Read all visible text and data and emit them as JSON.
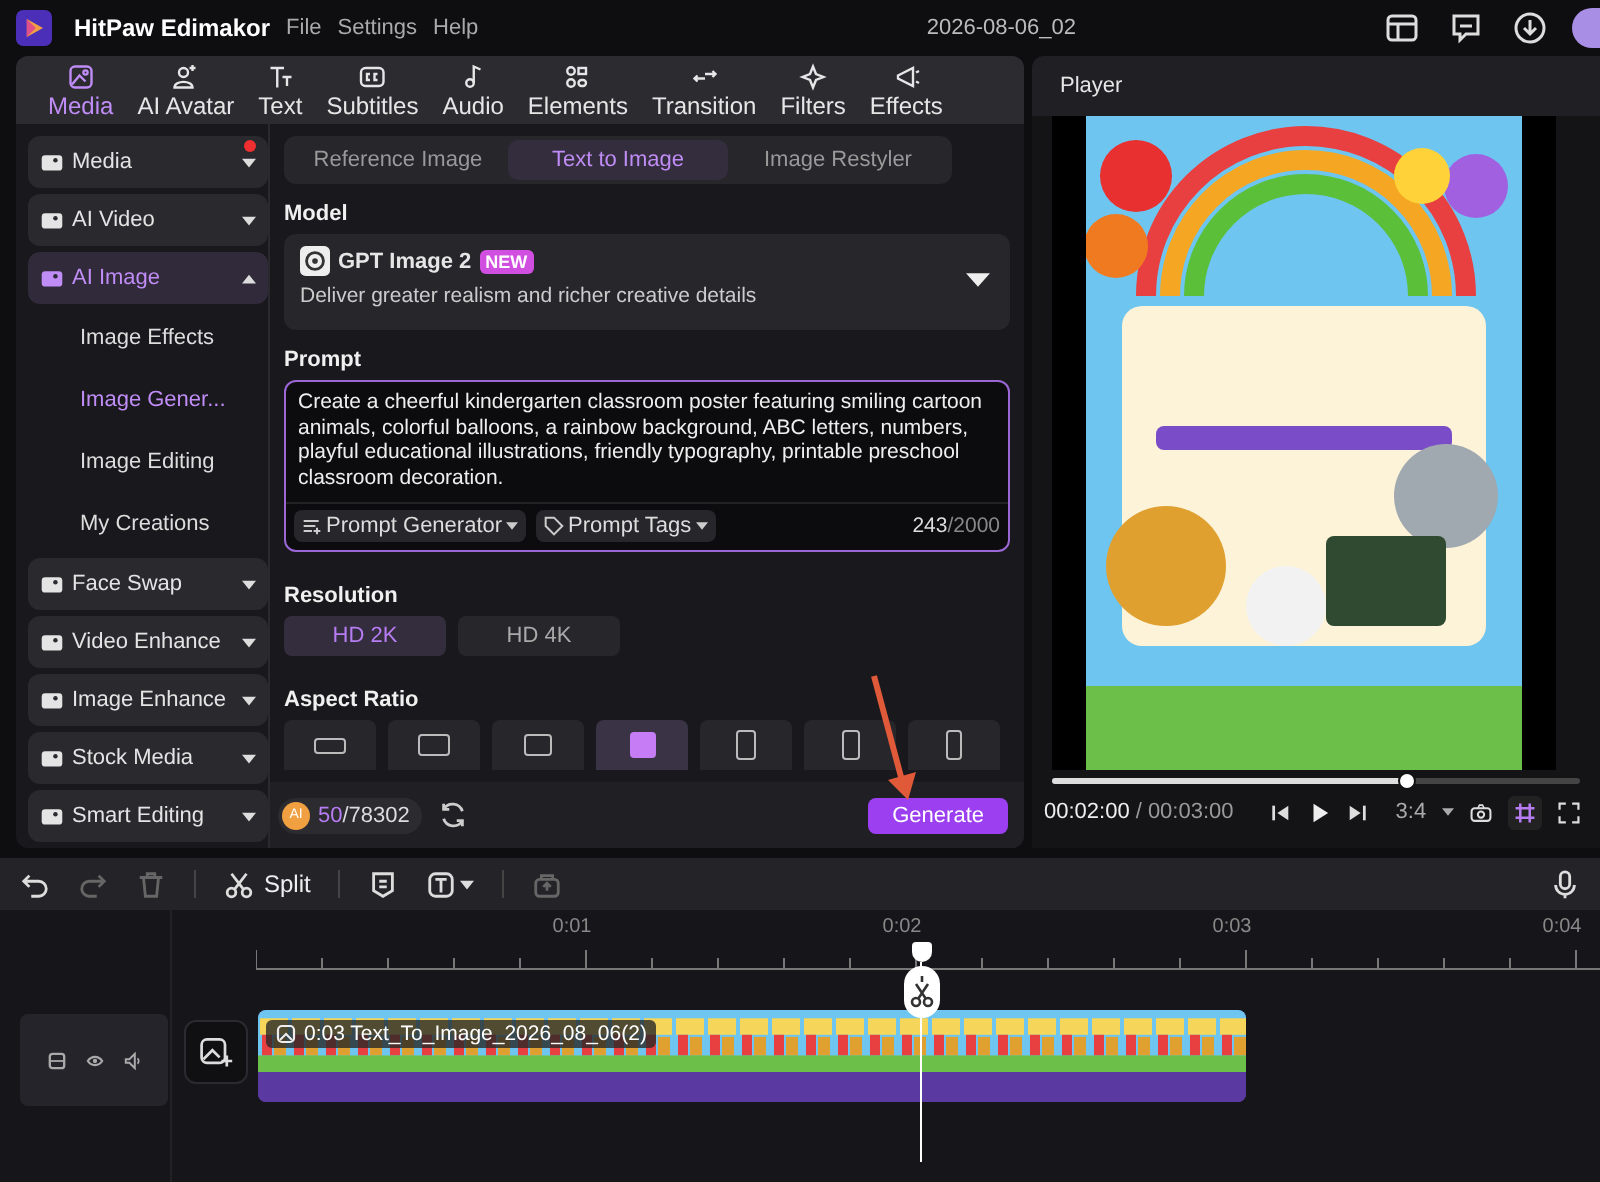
{
  "app": {
    "name": "HitPaw Edimakor",
    "menus": [
      "File",
      "Settings",
      "Help"
    ],
    "project": "2026-08-06_02"
  },
  "tabs": [
    {
      "label": "Media",
      "selected": true
    },
    {
      "label": "AI Avatar",
      "selected": false
    },
    {
      "label": "Text",
      "selected": false
    },
    {
      "label": "Subtitles",
      "selected": false
    },
    {
      "label": "Audio",
      "selected": false
    },
    {
      "label": "Elements",
      "selected": false
    },
    {
      "label": "Transition",
      "selected": false
    },
    {
      "label": "Filters",
      "selected": false
    },
    {
      "label": "Effects",
      "selected": false
    }
  ],
  "sidebar": [
    {
      "kind": "group",
      "label": "Media",
      "expanded": false,
      "selected": false,
      "alert": true
    },
    {
      "kind": "group",
      "label": "AI Video",
      "expanded": false,
      "selected": false,
      "alert": false
    },
    {
      "kind": "group",
      "label": "AI Image",
      "expanded": true,
      "selected": true,
      "alert": false
    },
    {
      "kind": "sub",
      "label": "Image Effects",
      "selected": false
    },
    {
      "kind": "sub",
      "label": "Image Gener...",
      "selected": true
    },
    {
      "kind": "sub",
      "label": "Image Editing",
      "selected": false
    },
    {
      "kind": "sub",
      "label": "My Creations",
      "selected": false
    },
    {
      "kind": "group",
      "label": "Face Swap",
      "expanded": false,
      "selected": false,
      "alert": false
    },
    {
      "kind": "group",
      "label": "Video Enhance",
      "expanded": false,
      "selected": false,
      "alert": false
    },
    {
      "kind": "group",
      "label": "Image Enhance",
      "expanded": false,
      "selected": false,
      "alert": false
    },
    {
      "kind": "group",
      "label": "Stock Media",
      "expanded": false,
      "selected": false,
      "alert": false
    },
    {
      "kind": "group",
      "label": "Smart Editing",
      "expanded": false,
      "selected": false,
      "alert": false
    }
  ],
  "modes": [
    {
      "label": "Reference Image",
      "selected": false
    },
    {
      "label": "Text to Image",
      "selected": true
    },
    {
      "label": "Image Restyler",
      "selected": false
    }
  ],
  "model": {
    "heading": "Model",
    "name": "GPT Image 2",
    "badge": "NEW",
    "description": "Deliver greater realism and richer creative details"
  },
  "prompt": {
    "heading": "Prompt",
    "value": "Create a cheerful kindergarten classroom poster featuring smiling cartoon animals, colorful balloons, a rainbow background, ABC letters, numbers, playful educational illustrations, friendly typography, printable preschool classroom decoration.",
    "tools": [
      "Prompt Generator",
      "Prompt Tags"
    ],
    "count": "243",
    "limit": "/2000"
  },
  "resolution": {
    "heading": "Resolution",
    "options": [
      {
        "label": "HD 2K",
        "selected": true
      },
      {
        "label": "HD 4K",
        "selected": false
      }
    ]
  },
  "aspect_ratio": {
    "heading": "Aspect Ratio",
    "options": [
      {
        "selected": false
      },
      {
        "selected": false
      },
      {
        "selected": false
      },
      {
        "selected": true
      },
      {
        "selected": false
      },
      {
        "selected": false
      },
      {
        "selected": false
      }
    ]
  },
  "credits": {
    "badge": "AI",
    "used": "50",
    "total": "/78302"
  },
  "generate": "Generate",
  "player": {
    "title": "Player",
    "level": 0.67,
    "current": "00:02:00",
    "total": "/ 00:03:00",
    "ratio": "3:4"
  },
  "timeline": {
    "split": "Split",
    "ticks": [
      "0:01",
      "0:02",
      "0:03",
      "0:04"
    ],
    "clip": "0:03 Text_To_Image_2026_08_06(2)"
  }
}
